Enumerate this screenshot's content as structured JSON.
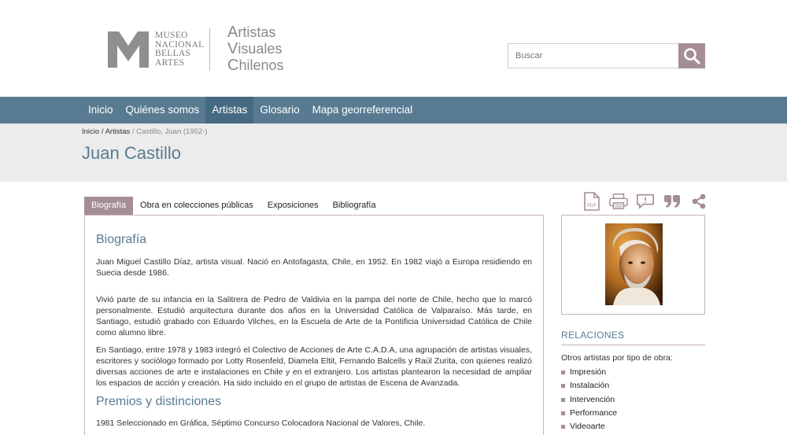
{
  "header": {
    "logo_mnba_lines": [
      "MUSEO",
      "NACIONAL",
      "BELLAS",
      "ARTES"
    ],
    "logo_avc": {
      "line1_cap": "A",
      "line1_rest": "rtistas",
      "line2_cap": "V",
      "line2_rest": "isuales",
      "line3_cap": "C",
      "line3_rest": "hilenos"
    },
    "search": {
      "placeholder": "Buscar"
    }
  },
  "nav": {
    "items": [
      {
        "label": "Inicio"
      },
      {
        "label": "Quiénes somos"
      },
      {
        "label": "Artistas"
      },
      {
        "label": "Glosario"
      },
      {
        "label": "Mapa georreferencial"
      }
    ],
    "active": "Artistas"
  },
  "breadcrumb": {
    "home": "Inicio",
    "sep1": " / ",
    "section": "Artistas",
    "sep2": " / ",
    "current": "Castillo, Juan (1952-)"
  },
  "page_title": "Juan Castillo",
  "tabs": [
    {
      "label": "Biografía"
    },
    {
      "label": "Obra en colecciones públicas"
    },
    {
      "label": "Exposiciones"
    },
    {
      "label": "Bibliografía"
    }
  ],
  "active_tab": "Biografía",
  "biography": {
    "heading": "Biografía",
    "paragraphs": [
      "Juan Miguel Castillo Díaz, artista visual. Nació en Antofagasta, Chile, en 1952. En 1982 viajó a Europa residiendo en Suecia desde 1986.",
      "Vivió parte de su infancia en la Salitrera de Pedro de Valdivia en la pampa del norte de Chile, hecho que lo marcó personalmente. Estudió arquitectura durante dos años en la Universidad Católica de Valparaíso. Más tarde, en Santiago, estudió grabado con Eduardo Vilches, en la Escuela de Arte de la Pontificia Universidad Católica de Chile como alumno libre.",
      "En Santiago, entre 1978 y 1983 integró el Colectivo de Acciones de Arte C.A.D.A, una agrupación de artistas visuales, escritores y sociólogo formado por Lotty Rosenfeld, Diamela Eltit, Fernando Balcells y Raúl Zurita, con quienes realizó diversas acciones de arte e instalaciones en Chile y en el extranjero. Los artistas plantearon la necesidad de ampliar los espacios de acción y creación. Ha sido incluido en el grupo de artistas de Escena de Avanzada."
    ]
  },
  "awards": {
    "heading": "Premios y distinciones",
    "items": [
      "1981 Seleccionado en Gráfica, Séptimo Concurso Colocadora Nacional de Valores, Chile."
    ]
  },
  "tools": {
    "icons": [
      "pdf-icon",
      "print-icon",
      "comment-icon",
      "quote-icon",
      "share-icon"
    ],
    "pdf_label": "PDF"
  },
  "relations": {
    "title": "RELACIONES",
    "subtitle": "Otros artistas por tipo de obra:",
    "items": [
      "Impresión",
      "Instalación",
      "Intervención",
      "Performance",
      "Videoarte"
    ]
  },
  "colors": {
    "accent": "#a58d96",
    "nav": "#587b92",
    "nav_active": "#466a81",
    "band": "#ececec",
    "title": "#587b92"
  }
}
